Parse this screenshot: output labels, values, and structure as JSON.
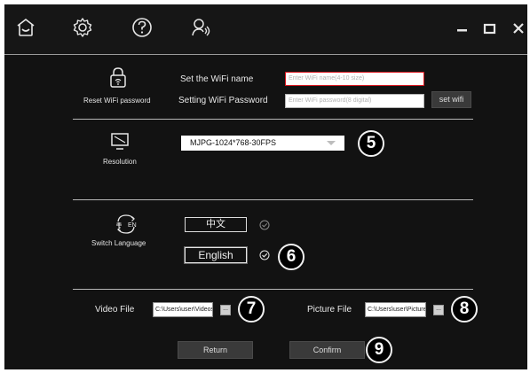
{
  "topbar": {
    "icons": [
      "home-icon",
      "gear-icon",
      "help-icon",
      "user-voice-icon"
    ],
    "window_controls": [
      "minimize-icon",
      "maximize-icon",
      "close-icon"
    ]
  },
  "wifi": {
    "section_label": "Reset WiFi password",
    "name_label": "Set the WiFi name",
    "name_placeholder": "Enter WiFi name(4-10 size)",
    "password_label": "Setting WiFi Password",
    "password_placeholder": "Enter WiFi password(8 digital)",
    "set_button": "set wifi"
  },
  "resolution": {
    "section_label": "Resolution",
    "selected": "MJPG-1024*768-30FPS"
  },
  "language": {
    "section_label": "Switch Language",
    "options": [
      "中文",
      "English"
    ],
    "selected": "English"
  },
  "files": {
    "video_label": "Video File",
    "video_path": "C:\\Users\\user\\Videos",
    "picture_label": "Picture File",
    "picture_path": "C:\\Users\\user\\Pictures",
    "browse_label": "..."
  },
  "actions": {
    "return_label": "Return",
    "confirm_label": "Confirm"
  },
  "callouts": [
    "5",
    "6",
    "7",
    "8",
    "9"
  ],
  "colors": {
    "background": "#121212",
    "field_highlight": "#d8141d",
    "button_gray": "#3a3a3a"
  }
}
